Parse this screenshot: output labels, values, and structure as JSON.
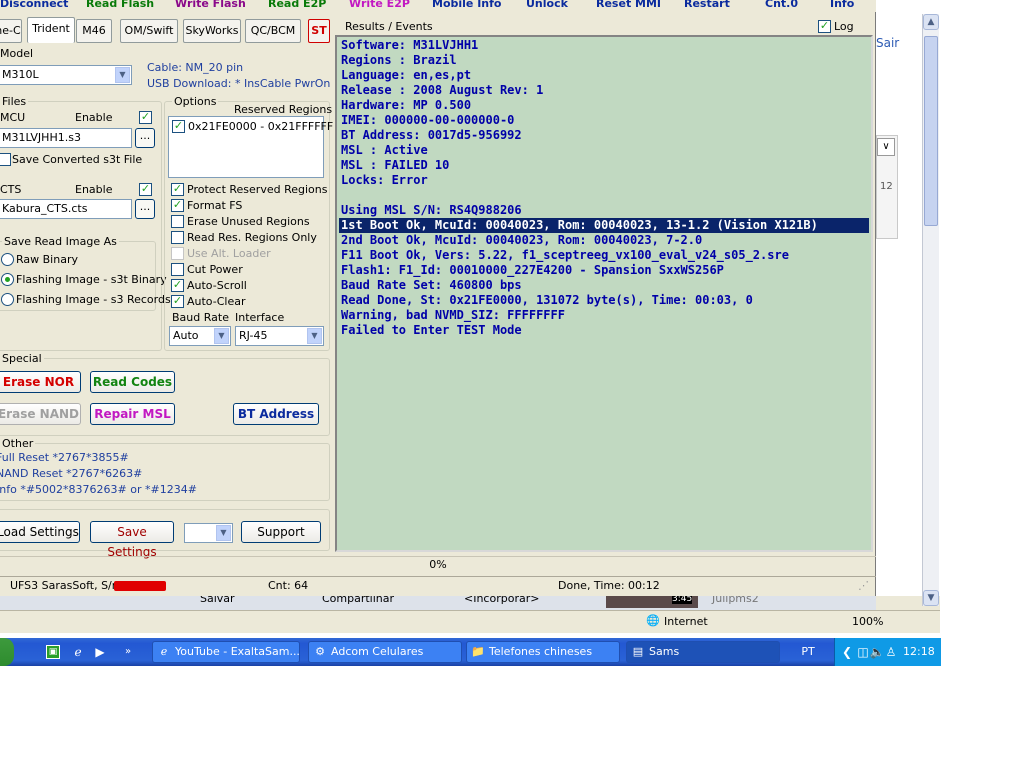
{
  "browser": {
    "login_link": "Sair",
    "side_number": "12",
    "bottom_toolbar": {
      "save": "Salvar",
      "share": "Compartilhar",
      "embed": "<Incorporar>",
      "video_time": "3:45",
      "user": "Julipms2"
    },
    "status_zone": "Internet",
    "zoom": "100%"
  },
  "menu": [
    "Disconnect",
    "Read Flash",
    "Write Flash",
    "Read E2P",
    "Write E2P",
    "Mobile Info",
    "Unlock",
    "Reset MMI",
    "Restart",
    "Cnt.0",
    "Info"
  ],
  "tabs": [
    "ne-C",
    "Trident",
    "M46",
    "OM/Swift",
    "SkyWorks",
    "QC/BCM",
    "ST"
  ],
  "active_tab": "Trident",
  "model": {
    "label": "Model",
    "value": "M310L",
    "cable": "Cable: NM_20 pin",
    "usb": "USB Download:  *  InsCable PwrOn"
  },
  "files": {
    "label": "Files",
    "mcu_label": "MCU",
    "mcu_enable": "Enable",
    "mcu_file": "M31LVJHH1.s3",
    "save_converted": "Save Converted s3t File",
    "cts_label": "CTS",
    "cts_enable": "Enable",
    "cts_file": "Kabura_CTS.cts",
    "browse": "..."
  },
  "save_read": {
    "label": "Save Read Image As",
    "options": [
      "Raw Binary",
      "Flashing Image - s3t Binary",
      "Flashing Image - s3 Records"
    ]
  },
  "options": {
    "label": "Options",
    "reserved_label": "Reserved Regions",
    "reserved_item": "0x21FE0000 - 0x21FFFFFF",
    "checks": [
      "Protect Reserved Regions",
      "Format FS",
      "Erase Unused Regions",
      "Read Res. Regions Only",
      "Use Alt. Loader",
      "Cut Power",
      "Auto-Scroll",
      "Auto-Clear"
    ],
    "baud_label": "Baud Rate",
    "baud_value": "Auto",
    "interface_label": "Interface",
    "interface_value": "RJ-45"
  },
  "special": {
    "label": "Special",
    "erase_nor": "Erase NOR",
    "read_codes": "Read Codes",
    "erase_nand": "Erase NAND",
    "repair_msl": "Repair MSL",
    "bt_address": "BT Address"
  },
  "other": {
    "label": "Other",
    "lines": [
      "Full Reset  *2767*3855#",
      "NAND Reset  *2767*6263#",
      "Info  *#5002*8376263#  or *#1234#"
    ]
  },
  "bottom_buttons": {
    "load": "Load Settings",
    "save": "Save Settings",
    "support": "Support"
  },
  "results": {
    "label": "Results / Events",
    "log_label": "Log",
    "lines": [
      "Software: M31LVJHH1",
      "Regions : Brazil",
      "Language: en,es,pt",
      "Release : 2008 August Rev: 1",
      "Hardware: MP 0.500",
      "IMEI: 000000-00-000000-0",
      "BT Address: 0017d5-956992",
      "MSL : Active",
      "MSL : FAILED 10",
      "Locks: Error",
      "",
      "Using MSL S/N: RS4Q988206",
      "1st Boot Ok, McuId: 00040023, Rom: 00040023, 13-1.2 (Vision X121B)",
      "2nd Boot Ok, McuId: 00040023, Rom: 00040023, 7-2.0",
      "F11 Boot Ok, Vers: 5.22, f1_sceptreeg_vx100_eval_v24_s05_2.sre",
      "Flash1: F1_Id: 00010000_227E4200 - Spansion SxxWS256P",
      "Baud Rate Set: 460800 bps",
      "Read Done, St: 0x21FE0000, 131072 byte(s), Time: 00:03, 0",
      "Warning, bad NVMD_SIZ: FFFFFFFF",
      "Failed to Enter TEST Mode"
    ]
  },
  "progress": "0%",
  "status": {
    "owner": "UFS3 SarasSoft, S/n:",
    "cnt": "Cnt: 64",
    "done": "Done, Time: 00:12"
  },
  "taskbar": {
    "tasks": [
      "YouTube - ExaltaSam...",
      "Adcom Celulares",
      "Telefones chineses",
      "Sams"
    ],
    "lang": "PT",
    "clock": "12:18"
  }
}
